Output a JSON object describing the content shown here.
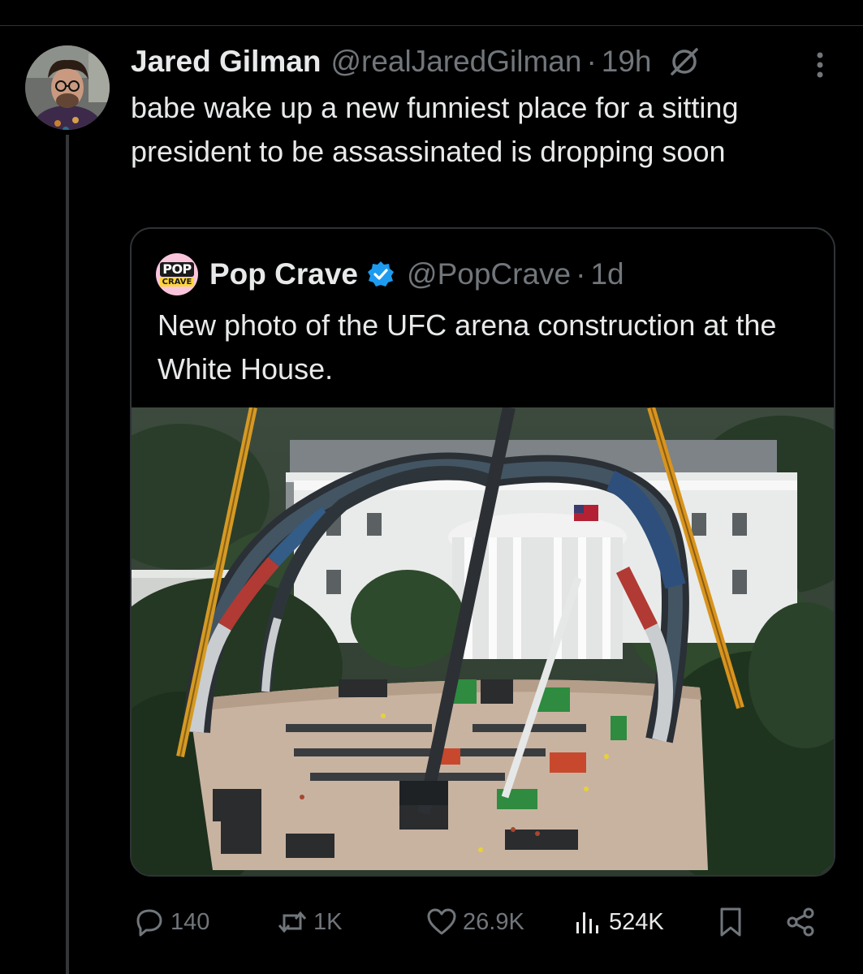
{
  "tweet": {
    "author_name": "Jared Gilman",
    "author_handle": "@realJaredGilman",
    "separator": "·",
    "time": "19h",
    "text": "babe wake up a new funniest place for a sitting president to be assassinated is dropping soon"
  },
  "quote": {
    "avatar_top": "POP",
    "avatar_bottom": "CRAVE",
    "author_name": "Pop Crave",
    "author_handle": "@PopCrave",
    "separator": "·",
    "time": "1d",
    "text": "New photo of the UFC arena construction at the White House."
  },
  "actions": {
    "replies": "140",
    "reposts": "1K",
    "likes": "26.9K",
    "views": "524K"
  },
  "icons": {
    "grok": "grok-icon",
    "more": "more-icon",
    "verified": "verified-badge-icon",
    "reply": "reply-icon",
    "repost": "repost-icon",
    "like": "heart-icon",
    "views": "views-icon",
    "bookmark": "bookmark-icon",
    "share": "share-icon"
  },
  "colors": {
    "background": "#000000",
    "text": "#e7e9ea",
    "muted": "#71767b",
    "border": "#2f3336",
    "verified_blue": "#1d9bf0"
  }
}
